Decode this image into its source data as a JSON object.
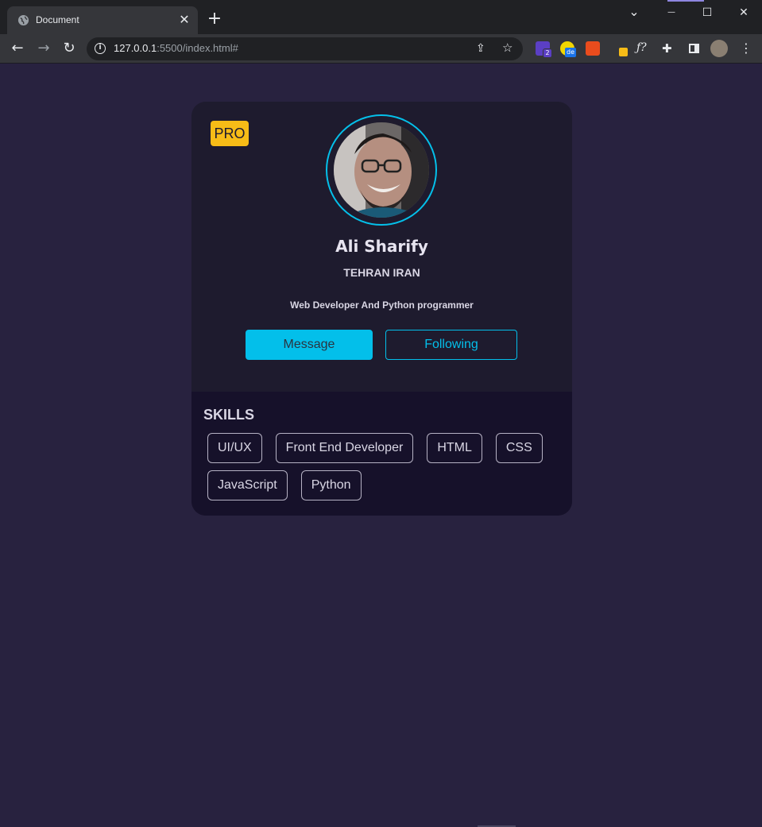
{
  "browser": {
    "tab_title": "Document",
    "tab_close": "✕",
    "new_tab": "+",
    "url_host": "127.0.0.1",
    "url_rest": ":5500/index.html#",
    "window_controls": {
      "tab_search": "⌄",
      "minimize": "—",
      "maximize": "☐",
      "close": "✕"
    },
    "nav": {
      "back": "←",
      "forward": "→",
      "reload": "↻"
    },
    "extension_badges": {
      "ext1_badge": "2",
      "ext2_badge": "de",
      "ext4_label": "ƒ?"
    },
    "icons": [
      "globe-icon",
      "close-icon",
      "plus-icon",
      "chevron-down-icon",
      "minimize-icon",
      "maximize-icon",
      "close-window-icon",
      "back-icon",
      "forward-icon",
      "reload-icon",
      "info-icon",
      "share-icon",
      "star-icon",
      "puzzle-icon",
      "sidebar-icon",
      "avatar-icon",
      "menu-icon"
    ]
  },
  "profile": {
    "badge": "PRO",
    "name": "Ali Sharify",
    "location": "TEHRAN IRAN",
    "bio": "Web Developer And Python programmer",
    "primary_button": "Message",
    "secondary_button": "Following",
    "skills_title": "SKILLS",
    "skills": [
      "UI/UX",
      "Front End Developer",
      "HTML",
      "CSS",
      "JavaScript",
      "Python"
    ]
  },
  "colors": {
    "page_bg": "#28223f",
    "card_bg": "#1e1b2e",
    "skills_bg": "#16112a",
    "accent": "#03bfea",
    "badge": "#f7bc17"
  }
}
